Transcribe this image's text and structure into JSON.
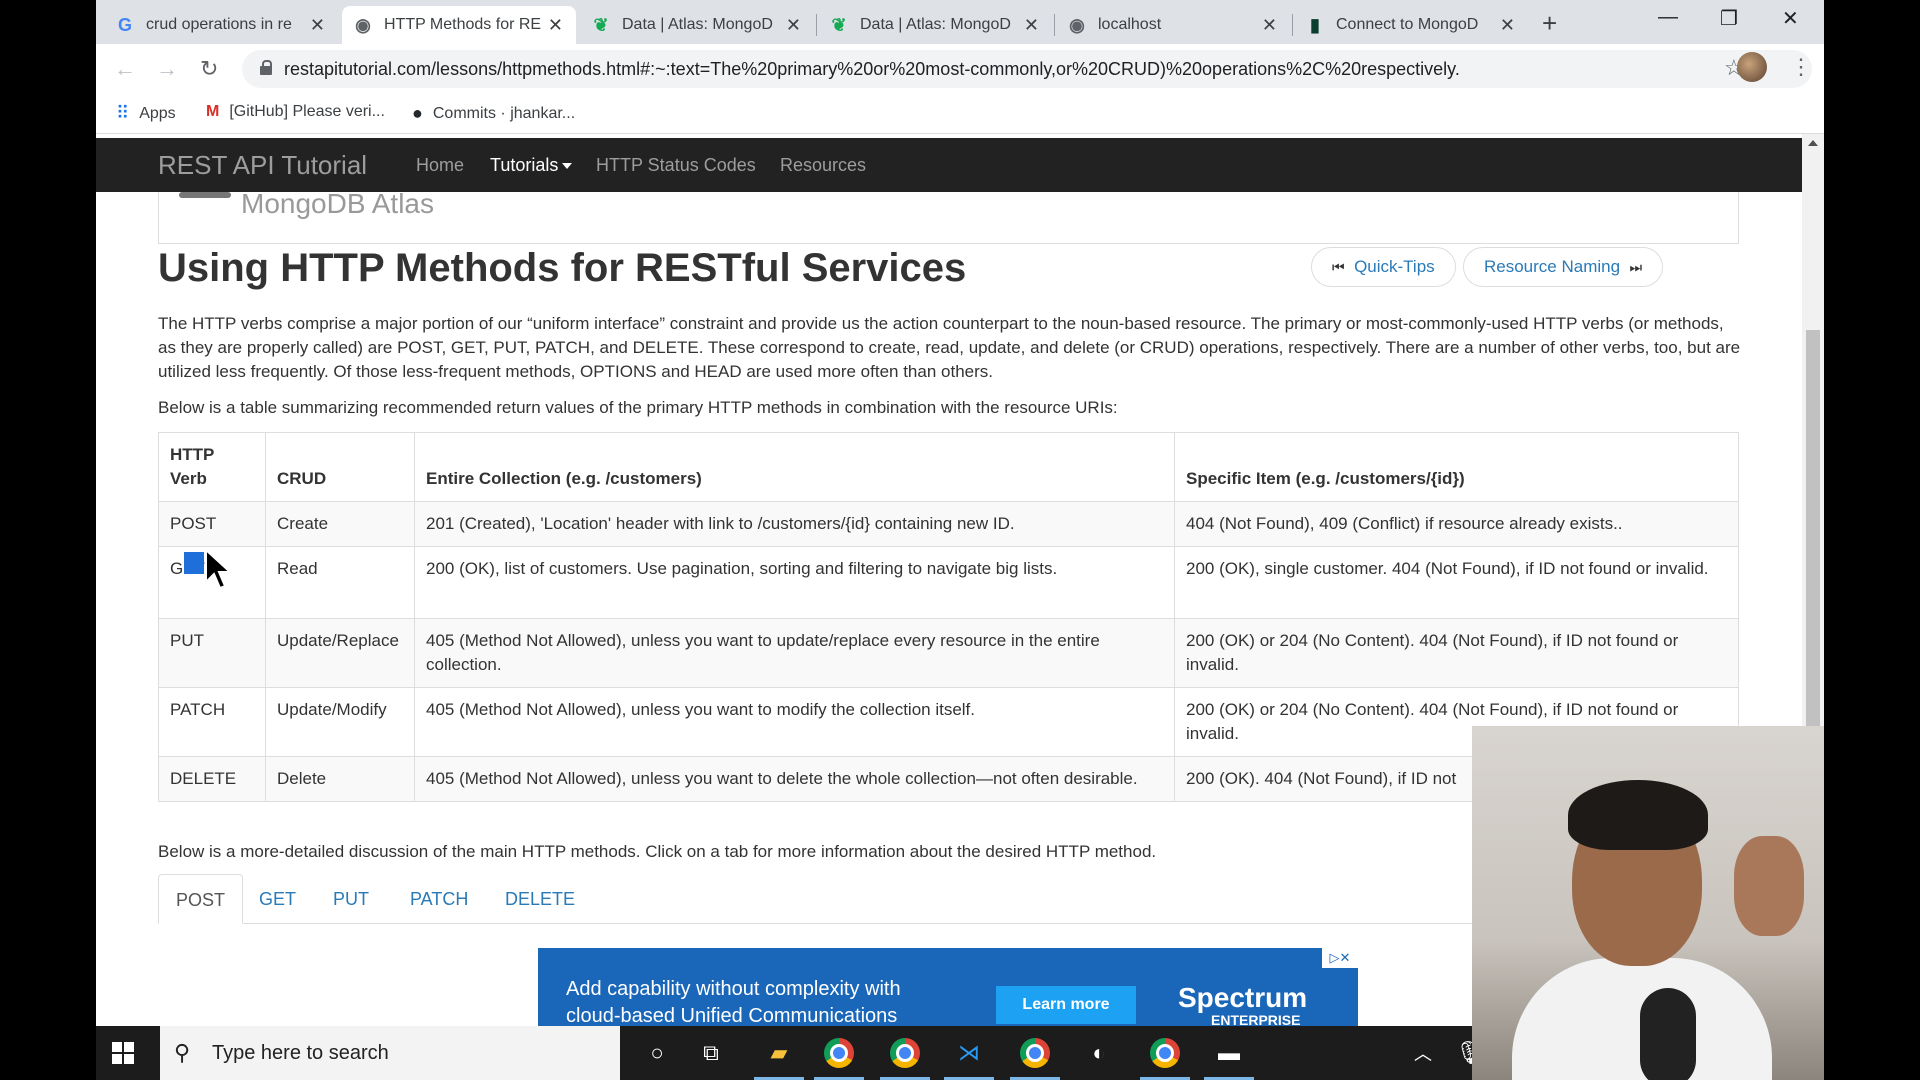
{
  "browser": {
    "tabs": [
      {
        "title": "crud operations in re",
        "fav": "G",
        "fav_color": "#4285f4"
      },
      {
        "title": "HTTP Methods for RE",
        "fav": "◉",
        "fav_color": "#5f6368"
      },
      {
        "title": "Data | Atlas: MongoD",
        "fav": "❦",
        "fav_color": "#13aa52"
      },
      {
        "title": "Data | Atlas: MongoD",
        "fav": "❦",
        "fav_color": "#13aa52"
      },
      {
        "title": "localhost",
        "fav": "◉",
        "fav_color": "#5f6368"
      },
      {
        "title": "Connect to MongoD",
        "fav": "▮",
        "fav_color": "#0b3d2e"
      }
    ],
    "url": "restapitutorial.com/lessons/httpmethods.html#:~:text=The%20primary%20or%20most-commonly,or%20CRUD)%20operations%2C%20respectively.",
    "bookmarks": [
      {
        "label": "Apps",
        "icon": "apps-grid-icon"
      },
      {
        "label": "[GitHub] Please veri...",
        "icon": "gmail-icon"
      },
      {
        "label": "Commits · jhankar...",
        "icon": "github-icon"
      }
    ]
  },
  "site": {
    "brand": "REST API Tutorial",
    "nav": [
      "Home",
      "Tutorials",
      "HTTP Status Codes",
      "Resources"
    ],
    "active_nav": "Tutorials",
    "ad_text": "MongoDB Atlas"
  },
  "article": {
    "title": "Using HTTP Methods for RESTful Services",
    "prev_link": "Quick-Tips",
    "next_link": "Resource Naming",
    "intro": "The HTTP verbs comprise a major portion of our “uniform interface” constraint and provide us the action counterpart to the noun-based resource. The primary or most-commonly-used HTTP verbs (or methods, as they are properly called) are POST, GET, PUT, PATCH, and DELETE. These correspond to create, read, update, and delete (or CRUD) operations, respectively. There are a number of other verbs, too, but are utilized less frequently. Of those less-frequent methods, OPTIONS and HEAD are used more often than others.",
    "table_intro": "Below is a table summarizing recommended return values of the primary HTTP methods in combination with the resource URIs:",
    "table_headers": [
      "HTTP Verb",
      "CRUD",
      "Entire Collection (e.g. /customers)",
      "Specific Item (e.g. /customers/{id})"
    ],
    "table_rows": [
      [
        "POST",
        "Create",
        "201 (Created), 'Location' header with link to /customers/{id} containing new ID.",
        "404 (Not Found), 409 (Conflict) if resource already exists.."
      ],
      [
        "GET",
        "Read",
        "200 (OK), list of customers. Use pagination, sorting and filtering to navigate big lists.",
        "200 (OK), single customer. 404 (Not Found), if ID not found or invalid."
      ],
      [
        "PUT",
        "Update/Replace",
        "405 (Method Not Allowed), unless you want to update/replace every resource in the entire collection.",
        "200 (OK) or 204 (No Content). 404 (Not Found), if ID not found or invalid."
      ],
      [
        "PATCH",
        "Update/Modify",
        "405 (Method Not Allowed), unless you want to modify the collection itself.",
        "200 (OK) or 204 (No Content). 404 (Not Found), if ID not found or invalid."
      ],
      [
        "DELETE",
        "Delete",
        "405 (Method Not Allowed), unless you want to delete the whole collection—not often desirable.",
        "200 (OK). 404 (Not Found), if ID not"
      ]
    ],
    "detail_intro": "Below is a more-detailed discussion of the main HTTP methods. Click on a tab for more information about the desired HTTP method.",
    "method_tabs": [
      "POST",
      "GET",
      "PUT",
      "PATCH",
      "DELETE"
    ],
    "active_method_tab": "POST"
  },
  "banner_ad": {
    "line1": "Add capability without complexity with",
    "line2": "cloud-based Unified Communications",
    "cta": "Learn more",
    "brand": "Spectrum",
    "brand_sub": "ENTERPRISE"
  },
  "taskbar": {
    "search_placeholder": "Type here to search"
  }
}
